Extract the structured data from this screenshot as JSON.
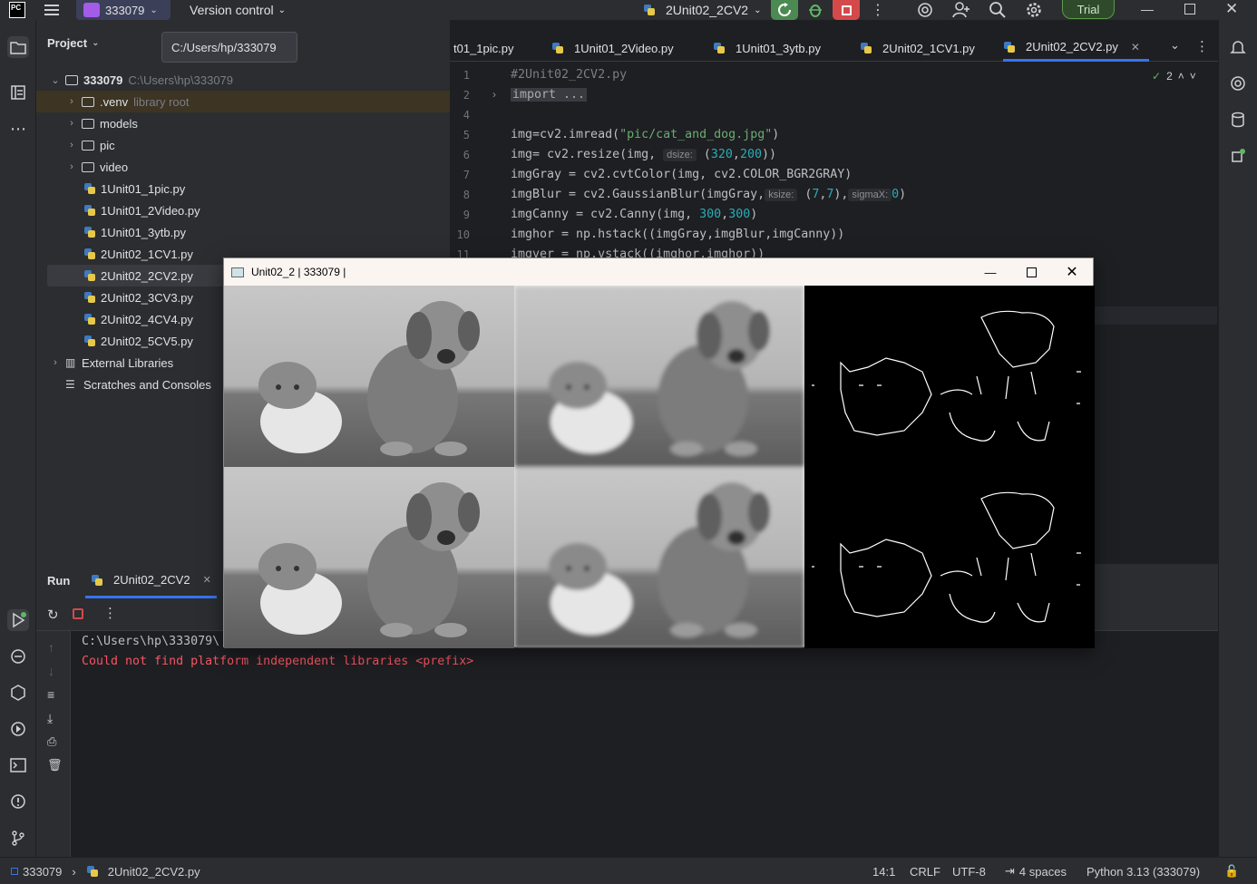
{
  "titlebar": {
    "app_logo": "PC",
    "project_name": "333079",
    "vcs_label": "Version control",
    "run_config": "2Unit02_2CV2",
    "trial_label": "Trial"
  },
  "tooltip": "C:/Users/hp/333079",
  "project_panel": {
    "title": "Project",
    "root_name": "333079",
    "root_path": "C:\\Users\\hp\\333079",
    "items": [
      {
        "label": ".venv",
        "note": "library root",
        "kind": "folder"
      },
      {
        "label": "models",
        "kind": "folder"
      },
      {
        "label": "pic",
        "kind": "folder"
      },
      {
        "label": "video",
        "kind": "folder"
      },
      {
        "label": "1Unit01_1pic.py",
        "kind": "py"
      },
      {
        "label": "1Unit01_2Video.py",
        "kind": "py"
      },
      {
        "label": "1Unit01_3ytb.py",
        "kind": "py"
      },
      {
        "label": "2Unit02_1CV1.py",
        "kind": "py"
      },
      {
        "label": "2Unit02_2CV2.py",
        "kind": "py"
      },
      {
        "label": "2Unit02_3CV3.py",
        "kind": "py"
      },
      {
        "label": "2Unit02_4CV4.py",
        "kind": "py"
      },
      {
        "label": "2Unit02_5CV5.py",
        "kind": "py"
      },
      {
        "label": "External Libraries",
        "kind": "lib"
      },
      {
        "label": "Scratches and Consoles",
        "kind": "scratch"
      }
    ]
  },
  "editor": {
    "tabs": [
      "t01_1pic.py",
      "1Unit01_2Video.py",
      "1Unit01_3ytb.py",
      "2Unit02_1CV1.py",
      "2Unit02_2CV2.py"
    ],
    "problems_count": "2",
    "line_numbers": [
      "1",
      "2",
      "4",
      "5",
      "6",
      "7",
      "8",
      "9",
      "10",
      "11"
    ],
    "lines": {
      "l1": "#2Unit02_2CV2.py",
      "l2": "import ...",
      "l5a": "img=cv2.imread(",
      "l5s": "\"pic/cat_and_dog.jpg\"",
      "l5b": ")",
      "l6a": "img= cv2.resize(img, ",
      "l6h": "dsize:",
      "l6b": " (",
      "l6n1": "320",
      "l6c": ",",
      "l6n2": "200",
      "l6d": "))",
      "l7": "imgGray = cv2.cvtColor(img, cv2.COLOR_BGR2GRAY)",
      "l8a": "imgBlur = cv2.GaussianBlur(imgGray,",
      "l8h1": "ksize:",
      "l8b": " (",
      "l8n1": "7",
      "l8c": ",",
      "l8n2": "7",
      "l8d": "),",
      "l8h2": "sigmaX:",
      "l8n3": "0",
      "l8e": ")",
      "l9a": "imgCanny = cv2.Canny(img, ",
      "l9n1": "300",
      "l9c": ",",
      "l9n2": "300",
      "l9d": ")",
      "l10": "imghor = np.hstack((imgGray,imgBlur,imgCanny))",
      "l11": "imgver = np.vstack((imghor,imghor))"
    }
  },
  "run_panel": {
    "title": "Run",
    "tab_label": "2Unit02_2CV2",
    "console_line1": "C:\\Users\\hp\\333079\\",
    "console_line2": "Could not find platform independent libraries <prefix>"
  },
  "cv_window": {
    "title": "Unit02_2 | 333079 |"
  },
  "statusbar": {
    "breadcrumb_project": "333079",
    "breadcrumb_file": "2Unit02_2CV2.py",
    "position": "14:1",
    "line_sep": "CRLF",
    "encoding": "UTF-8",
    "indent": "4 spaces",
    "interpreter": "Python 3.13 (333079)"
  },
  "colors": {
    "accent": "#3574f0",
    "run_green": "#4b8b52",
    "stop_red": "#d44a4a",
    "error_text": "#f75464"
  }
}
